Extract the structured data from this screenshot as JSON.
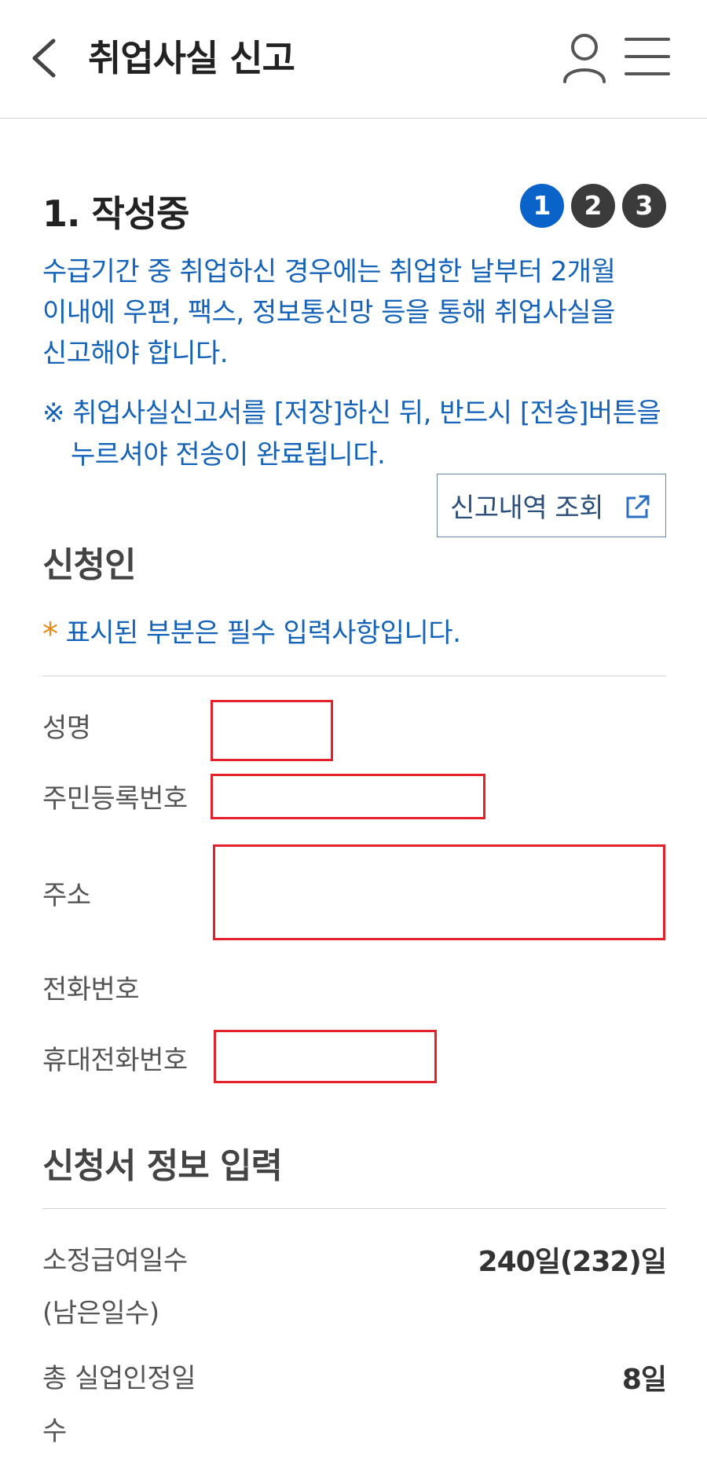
{
  "header": {
    "title": "취업사실 신고",
    "back_icon": "chevron-left-icon",
    "user_icon": "user-icon",
    "menu_icon": "hamburger-menu-icon"
  },
  "progress": {
    "title": "1. 작성중",
    "steps": [
      "1",
      "2",
      "3"
    ],
    "active_step": 1,
    "active_color": "#0a63c9",
    "inactive_color": "#3b3b3b"
  },
  "info": {
    "line1": "수급기간 중 취업하신 경우에는 취업한 날부터 2개월",
    "line2": "이내에 우편, 팩스, 정보통신망 등을 통해 취업사실을",
    "line3": "신고해야 합니다.",
    "notice": "※ 취업사실신고서를 [저장]하신 뒤, 반드시 [전송]버튼을 누르셔야 전송이 완료됩니다.",
    "history_button": "신고내역 조회",
    "history_icon": "external-link-icon"
  },
  "applicant": {
    "title": "신청인",
    "required_mark": "*",
    "required_text": "표시된 부분은 필수 입력사항입니다.",
    "name_label": "성명",
    "rrn_label": "주민등록번호",
    "address_label": "주소",
    "phone_label": "전화번호",
    "mobile_label": "휴대전화번호"
  },
  "application": {
    "title": "신청서 정보 입력",
    "benefit_days_label_1": "소정급여일수",
    "benefit_days_label_2": "(남은일수)",
    "benefit_days_value": "240일(232)일",
    "unemployment_days_label_1": "총 실업인정일",
    "unemployment_days_label_2": "수",
    "unemployment_days_value": "8일"
  },
  "colors": {
    "accent_blue": "#1463b8",
    "required_star": "#e98a17",
    "redaction_border": "#e4202b"
  }
}
